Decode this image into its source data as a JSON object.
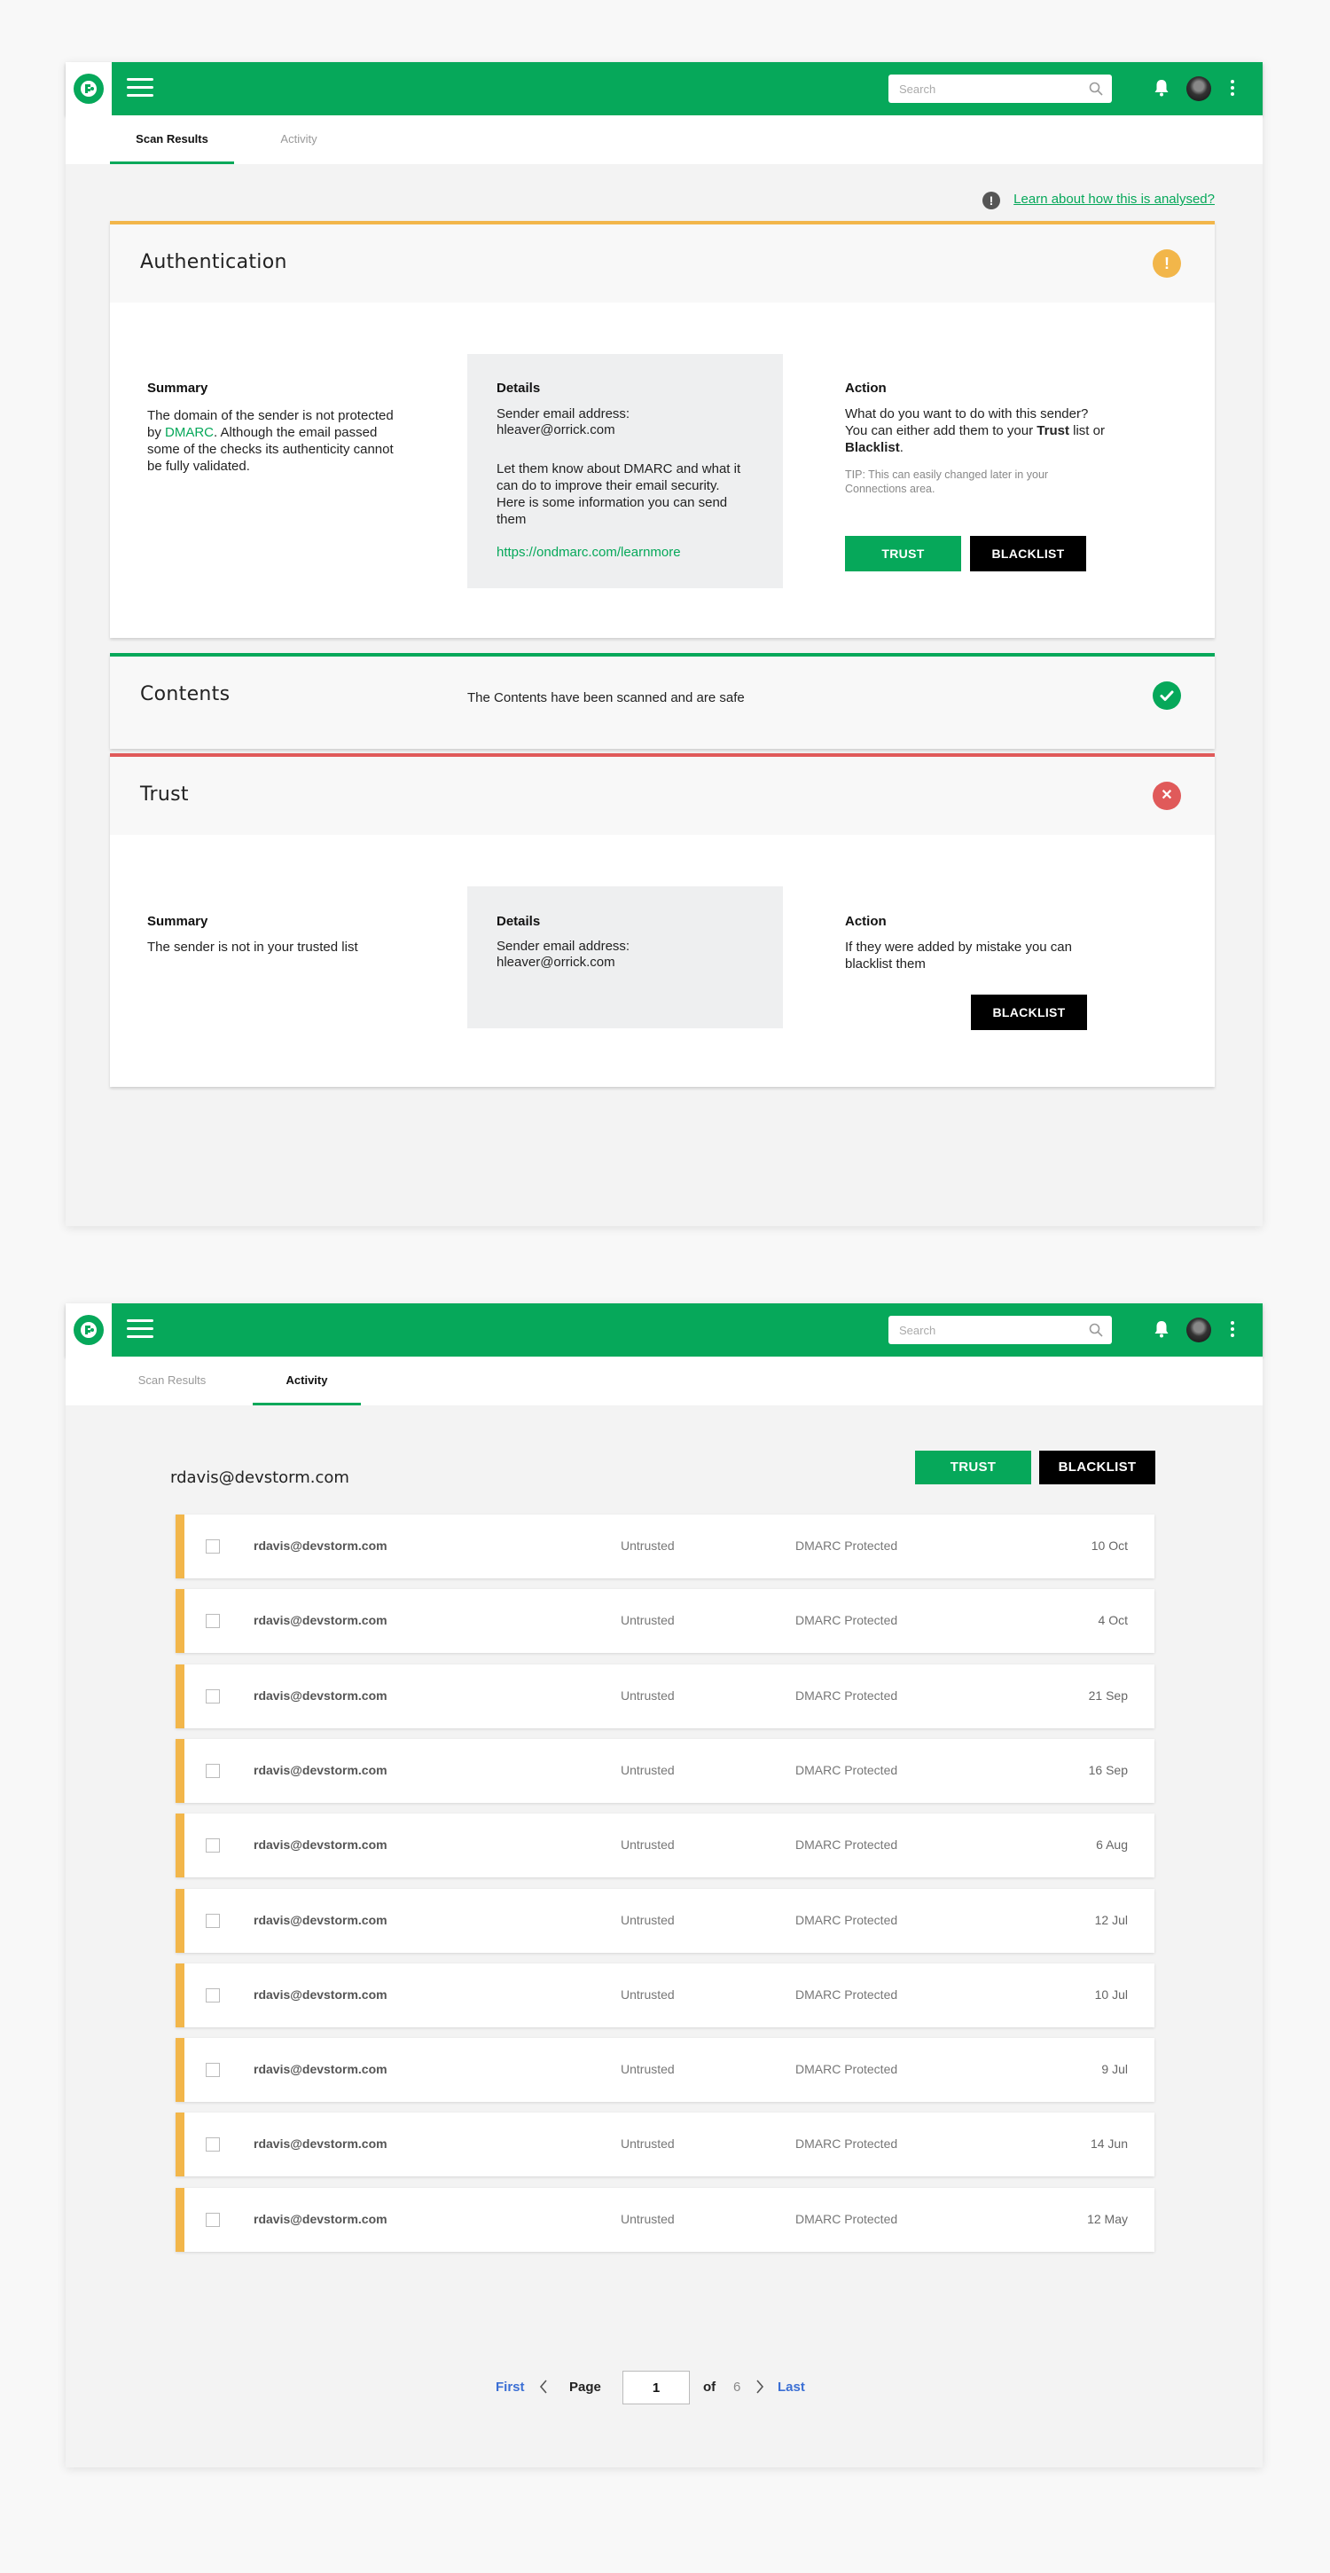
{
  "colors": {
    "brand": "#06a85a",
    "warning": "#f2b64a",
    "danger": "#e05a5a",
    "black": "#000000"
  },
  "topbar": {
    "search_placeholder": "Search",
    "logo_icon": "logo-icon",
    "menu_icon": "hamburger-icon",
    "bell_icon": "bell-icon",
    "more_icon": "kebab-icon"
  },
  "tabs": [
    {
      "label": "Scan Results"
    },
    {
      "label": "Activity"
    }
  ],
  "scan": {
    "learn_link": "Learn about how this is analysed?",
    "authentication": {
      "title": "Authentication",
      "status": "warning",
      "summary_heading": "Summary",
      "summary_text_1": "The domain of the sender is not protected by",
      "summary_link": "DMARC",
      "summary_text_2": ". Although the email passed some of the checks its authenticity cannot be fully validated.",
      "details_heading": "Details",
      "details_label": "Sender email address:",
      "details_email": "hleaver@orrick.com",
      "details_text": "Let them know about DMARC and what it can do to improve their email security. Here is some information you can send them",
      "details_link": "https://ondmarc.com/learnmore",
      "action_heading": "Action",
      "action_text_1": "What do you want to do with this sender? You can either add them to your",
      "action_trust_word": "Trust",
      "action_text_2": "list or",
      "action_blacklist_word": "Blacklist",
      "action_text_3": ".",
      "tip": "TIP: This can easily changed later in your Connections area.",
      "trust_button": "TRUST",
      "blacklist_button": "BLACKLIST"
    },
    "contents": {
      "title": "Contents",
      "message": "The Contents have been scanned and are safe",
      "status": "safe"
    },
    "trust": {
      "title": "Trust",
      "status": "danger",
      "summary_heading": "Summary",
      "summary_text": "The sender is not in your trusted list",
      "details_heading": "Details",
      "details_label": "Sender email address:",
      "details_email": "hleaver@orrick.com",
      "action_heading": "Action",
      "action_text": "If they were added by mistake you can blacklist them",
      "blacklist_button": "BLACKLIST"
    }
  },
  "activity": {
    "sender": "rdavis@devstorm.com",
    "trust_button": "TRUST",
    "blacklist_button": "BLACKLIST",
    "rows": [
      {
        "email": "rdavis@devstorm.com",
        "status": "Untrusted",
        "protection": "DMARC Protected",
        "date": "10 Oct"
      },
      {
        "email": "rdavis@devstorm.com",
        "status": "Untrusted",
        "protection": "DMARC Protected",
        "date": "4 Oct"
      },
      {
        "email": "rdavis@devstorm.com",
        "status": "Untrusted",
        "protection": "DMARC Protected",
        "date": "21 Sep"
      },
      {
        "email": "rdavis@devstorm.com",
        "status": "Untrusted",
        "protection": "DMARC Protected",
        "date": "16 Sep"
      },
      {
        "email": "rdavis@devstorm.com",
        "status": "Untrusted",
        "protection": "DMARC Protected",
        "date": "6 Aug"
      },
      {
        "email": "rdavis@devstorm.com",
        "status": "Untrusted",
        "protection": "DMARC Protected",
        "date": "12 Jul"
      },
      {
        "email": "rdavis@devstorm.com",
        "status": "Untrusted",
        "protection": "DMARC Protected",
        "date": "10 Jul"
      },
      {
        "email": "rdavis@devstorm.com",
        "status": "Untrusted",
        "protection": "DMARC Protected",
        "date": "9 Jul"
      },
      {
        "email": "rdavis@devstorm.com",
        "status": "Untrusted",
        "protection": "DMARC Protected",
        "date": "14 Jun"
      },
      {
        "email": "rdavis@devstorm.com",
        "status": "Untrusted",
        "protection": "DMARC Protected",
        "date": "12 May"
      }
    ],
    "pager": {
      "first": "First",
      "page_label": "Page",
      "current": "1",
      "of_label": "of",
      "total": "6",
      "last": "Last"
    }
  }
}
